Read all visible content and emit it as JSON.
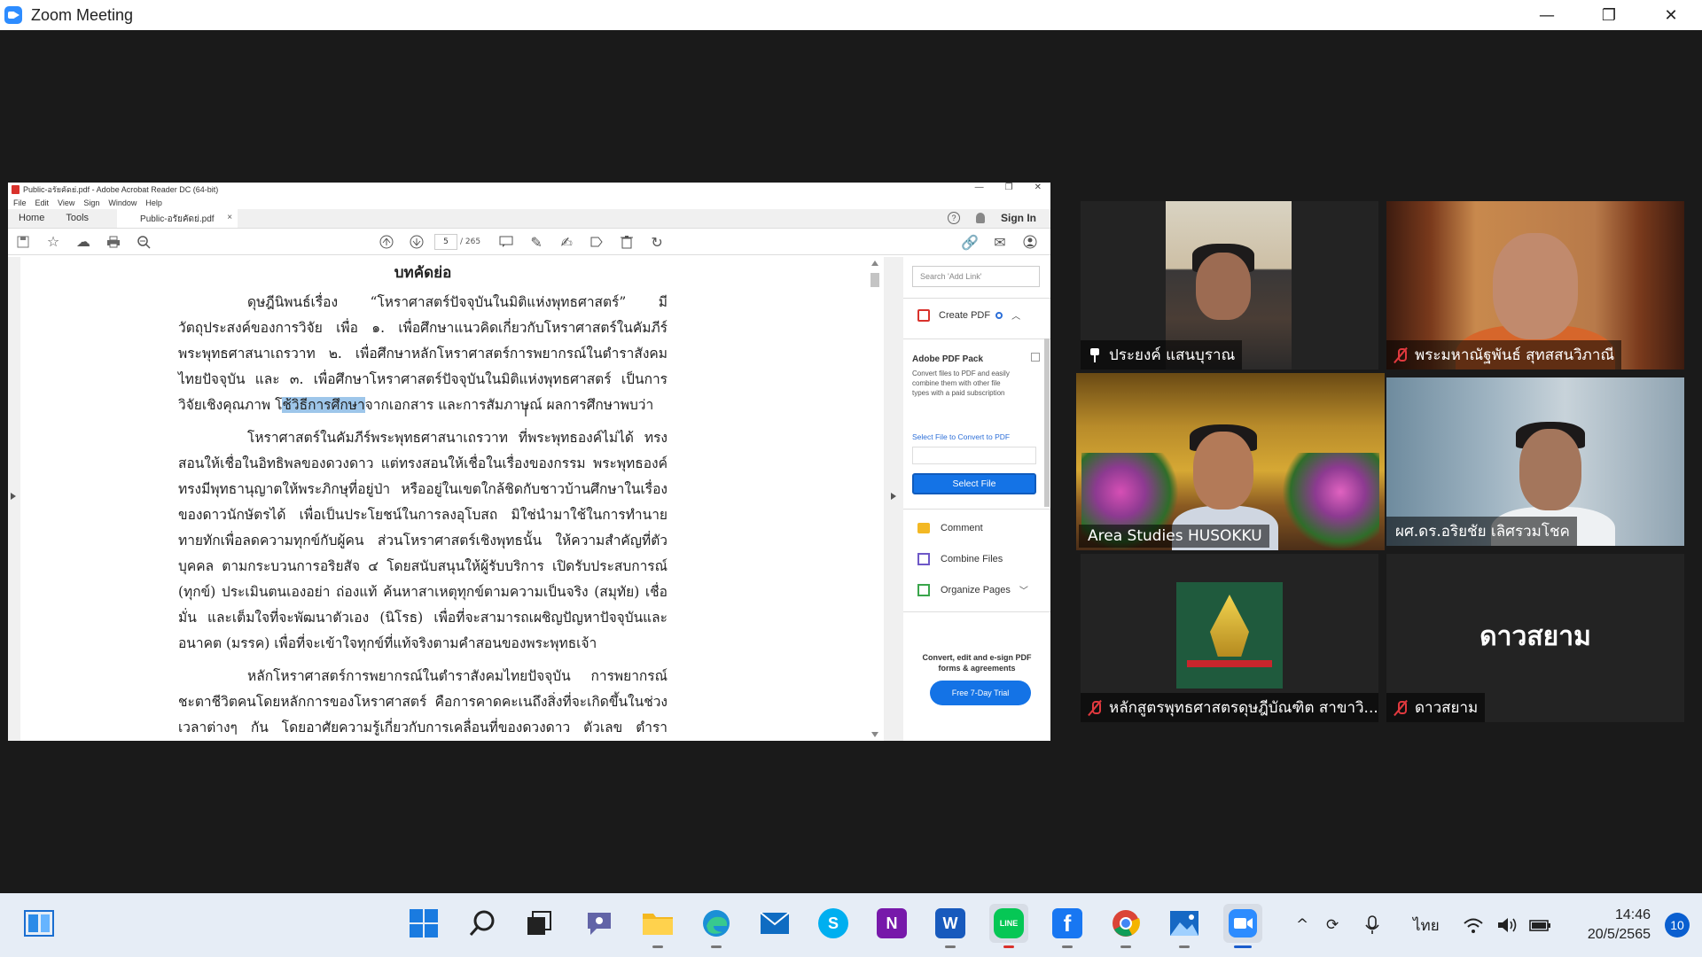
{
  "zoom": {
    "title": "Zoom Meeting",
    "minimize": "—",
    "restore": "❐",
    "close": "✕"
  },
  "acrobat": {
    "window_title": "Public-อรัยคัดย่.pdf - Adobe Acrobat Reader DC (64-bit)",
    "window_ctrls": [
      "—",
      "❐",
      "✕"
    ],
    "menu": [
      "File",
      "Edit",
      "View",
      "Sign",
      "Window",
      "Help"
    ],
    "tabs": {
      "home": "Home",
      "tools": "Tools",
      "doc": "Public-อรัยคัดย่.pdf",
      "close": "×"
    },
    "help": "?",
    "sign_in": "Sign In",
    "page_current": "5",
    "page_total": "/ 265",
    "doc": {
      "heading": "บทคัดย่อ",
      "p1_pre": "ดุษฎีนิพนธ์เรื่อง “โหราศาสตร์ปัจจุบันในมิติแห่งพุทธศาสตร์” มีวัตถุประสงค์ของการวิจัย เพื่อ ๑. เพื่อศึกษาแนวคิดเกี่ยวกับโหราศาสตร์ในคัมภีร์พระพุทธศาสนาเถรวาท ๒. เพื่อศึกษาหลักโหราศาสตร์การพยากรณ์ในตำราสังคมไทยปัจจุบัน และ ๓. เพื่อศึกษาโหราศาสตร์ปัจจุบันในมิติแห่งพุทธศาสตร์ เป็นการวิจัยเชิงคุณภาพ โ",
      "p1_hl": "ช้วิธีการศึกษา",
      "p1_post": "จากเอกสาร และการสัมภาษณ์ ผลการศึกษาพบว่า",
      "p2": "โหราศาสตร์ในคัมภีร์พระพุทธศาสนาเถรวาท ที่พระพุทธองค์ไม่ได้ ทรงสอนให้เชื่อในอิทธิพลของดวงดาว แต่ทรงสอนให้เชื่อในเรื่องของกรรม พระพุทธองค์ทรงมีพุทธานุญาตให้พระภิกษุที่อยู่ป่า หรืออยู่ในเขตใกล้ชิดกับชาวบ้านศึกษาในเรื่องของดาวนักษัตรได้ เพื่อเป็นประโยชน์ในการลงอุโบสถ มิใช่นำมาใช้ในการทำนายทายทักเพื่อลดความทุกข์กับผู้คน ส่วนโหราศาสตร์เชิงพุทธนั้น ให้ความสำคัญที่ตัวบุคคล ตามกระบวนการอริยสัจ ๔ โดยสนับสนุนให้ผู้รับบริการ เปิดรับประสบการณ์ (ทุกข์) ประเมินตนเองอย่า ถ่องแท้ ค้นหาสาเหตุทุกข์ตามความเป็นจริง (สมุทัย) เชื่อมั่น และเต็มใจที่จะพัฒนาตัวเอง (นิโรธ) เพื่อที่จะสามารถเผชิญปัญหาปัจจุบันและอนาคต (มรรค) เพื่อที่จะเข้าใจทุกข์ที่แท้จริงตามคำสอนของพระพุทธเจ้า",
      "p3": "หลักโหราศาสตร์การพยากรณ์ในตำราสังคมไทยปัจจุบัน การพยากรณ์ชะตาชีวิตคนโดยหลักการของโหราศาสตร์ คือการคาดคะเนถึงสิ่งที่จะเกิดขึ้นในช่วงเวลาต่างๆ กัน โดยอาศัยความรู้เกี่ยวกับการเคลื่อนที่ของดวงดาว ตัวเลข ตำราโหราศาสตร์ มาประกอบ บนความเชื่อเรื่อง กรรม"
    },
    "right_pane": {
      "search_placeholder": "Search 'Add Link'",
      "create_pdf": "Create PDF",
      "pack_title": "Adobe PDF Pack",
      "pack_desc": "Convert files to PDF and easily combine them with other file types with a paid subscription",
      "select_label": "Select File to Convert to PDF",
      "select_btn": "Select File",
      "comment": "Comment",
      "combine": "Combine Files",
      "organize": "Organize Pages",
      "promo": "Convert, edit and e-sign PDF forms & agreements",
      "trial": "Free 7-Day Trial"
    }
  },
  "participants": [
    {
      "name": "ประยงค์ แสนบุราณ",
      "pinned": true,
      "muted": false
    },
    {
      "name": "พระมหาณัฐพันธ์ สุทสสนวิภาณี",
      "pinned": false,
      "muted": true
    },
    {
      "name": "Area Studies HUSOKKU",
      "pinned": false,
      "muted": false,
      "active": true
    },
    {
      "name": "ผศ.ดร.อริยชัย เลิศรวมโชค",
      "pinned": false,
      "muted": false
    },
    {
      "name": "หลักสูตรพุทธศาสตรดุษฎีบัณฑิต สาขาวิ...",
      "pinned": false,
      "muted": true
    },
    {
      "name": "ดาวสยาม",
      "pinned": false,
      "muted": true,
      "big_label": "ดาวสยาม"
    }
  ],
  "taskbar": {
    "apps": [
      "windows-start",
      "search",
      "task-view",
      "teams-chat",
      "file-explorer",
      "edge",
      "mail",
      "skype",
      "onenote",
      "word",
      "line",
      "facebook",
      "chrome",
      "photos",
      "zoom"
    ],
    "word_letter": "W",
    "onenote_letter": "N",
    "facebook_letter": "f",
    "skype_letter": "S",
    "line_label": "LINE",
    "lang": "ไทย",
    "time": "14:46",
    "date": "20/5/2565",
    "notifications": "10",
    "colors": {
      "accent": "#1a5ccc",
      "line": "#06c755",
      "word": "#185abd",
      "onenote": "#7719aa",
      "facebook": "#1877f2",
      "skype": "#00aff0"
    }
  }
}
